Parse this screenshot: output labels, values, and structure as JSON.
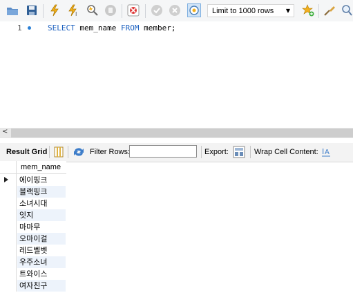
{
  "toolbar": {
    "limit_label": "Limit to 1000 rows",
    "icons": [
      "open-folder-icon",
      "save-icon",
      "execute-icon",
      "execute-current-icon",
      "explain-icon",
      "stop-icon",
      "toggle-error-icon",
      "commit-icon",
      "rollback-icon",
      "autocommit-icon",
      "bookmark-star-icon",
      "beautify-icon",
      "search-icon"
    ]
  },
  "editor": {
    "line_number": "1",
    "keyword_select": "SELECT",
    "column": " mem_name ",
    "keyword_from": "FROM",
    "table": " member;"
  },
  "result_bar": {
    "result_grid": "Result Grid",
    "filter_rows": "Filter Rows:",
    "export": "Export:",
    "wrap": "Wrap Cell Content:"
  },
  "grid": {
    "column_header": "mem_name",
    "rows": [
      "에이핑크",
      "블랙핑크",
      "소녀시대",
      "잇지",
      "마마무",
      "오마이걸",
      "레드벨벳",
      "우주소녀",
      "트와이스",
      "여자친구"
    ]
  },
  "colors": {
    "keyword": "#1a5fbf",
    "alt_row": "#edf3fb"
  }
}
